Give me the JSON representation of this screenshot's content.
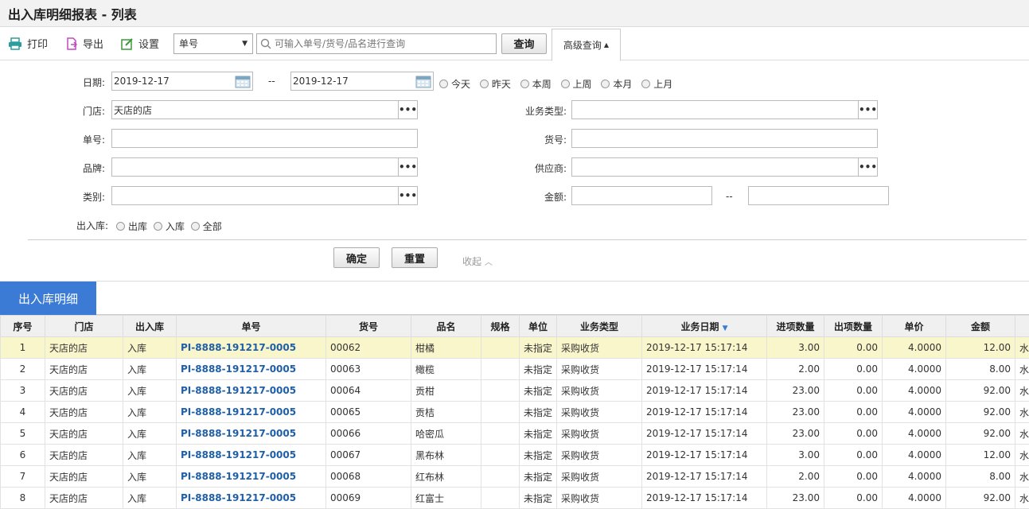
{
  "title": "出入库明细报表 - 列表",
  "toolbar": {
    "print": "打印",
    "export": "导出",
    "settings": "设置",
    "select_value": "单号",
    "search_placeholder": "可输入单号/货号/品名进行查询",
    "query": "查询",
    "advanced": "高级查询"
  },
  "form": {
    "date_label": "日期:",
    "date_from": "2019-12-17",
    "date_sep": "--",
    "date_to": "2019-12-17",
    "quick_dates": [
      "今天",
      "昨天",
      "本周",
      "上周",
      "本月",
      "上月"
    ],
    "store_label": "门店:",
    "store_value": "天店的店",
    "biztype_label": "业务类型:",
    "order_label": "单号:",
    "item_label": "货号:",
    "brand_label": "品牌:",
    "supplier_label": "供应商:",
    "category_label": "类别:",
    "amount_label": "金额:",
    "amount_sep": "--",
    "io_label": "出入库:",
    "io_options": [
      "出库",
      "入库",
      "全部"
    ],
    "confirm": "确定",
    "reset": "重置",
    "collapse": "收起",
    "dots": "•••"
  },
  "tab": "出入库明细",
  "table": {
    "headers": [
      "序号",
      "门店",
      "出入库",
      "单号",
      "货号",
      "品名",
      "规格",
      "单位",
      "业务类型",
      "业务日期",
      "进项数量",
      "出项数量",
      "单价",
      "金额",
      ""
    ],
    "rows": [
      [
        "1",
        "天店的店",
        "入库",
        "PI-8888-191217-0005",
        "00062",
        "柑橘",
        "",
        "未指定",
        "采购收货",
        "2019-12-17 15:17:14",
        "3.00",
        "0.00",
        "4.0000",
        "12.00",
        "水"
      ],
      [
        "2",
        "天店的店",
        "入库",
        "PI-8888-191217-0005",
        "00063",
        "橄榄",
        "",
        "未指定",
        "采购收货",
        "2019-12-17 15:17:14",
        "2.00",
        "0.00",
        "4.0000",
        "8.00",
        "水"
      ],
      [
        "3",
        "天店的店",
        "入库",
        "PI-8888-191217-0005",
        "00064",
        "贡柑",
        "",
        "未指定",
        "采购收货",
        "2019-12-17 15:17:14",
        "23.00",
        "0.00",
        "4.0000",
        "92.00",
        "水"
      ],
      [
        "4",
        "天店的店",
        "入库",
        "PI-8888-191217-0005",
        "00065",
        "贡桔",
        "",
        "未指定",
        "采购收货",
        "2019-12-17 15:17:14",
        "23.00",
        "0.00",
        "4.0000",
        "92.00",
        "水"
      ],
      [
        "5",
        "天店的店",
        "入库",
        "PI-8888-191217-0005",
        "00066",
        "哈密瓜",
        "",
        "未指定",
        "采购收货",
        "2019-12-17 15:17:14",
        "23.00",
        "0.00",
        "4.0000",
        "92.00",
        "水"
      ],
      [
        "6",
        "天店的店",
        "入库",
        "PI-8888-191217-0005",
        "00067",
        "黑布林",
        "",
        "未指定",
        "采购收货",
        "2019-12-17 15:17:14",
        "3.00",
        "0.00",
        "4.0000",
        "12.00",
        "水"
      ],
      [
        "7",
        "天店的店",
        "入库",
        "PI-8888-191217-0005",
        "00068",
        "红布林",
        "",
        "未指定",
        "采购收货",
        "2019-12-17 15:17:14",
        "2.00",
        "0.00",
        "4.0000",
        "8.00",
        "水"
      ],
      [
        "8",
        "天店的店",
        "入库",
        "PI-8888-191217-0005",
        "00069",
        "红富士",
        "",
        "未指定",
        "采购收货",
        "2019-12-17 15:17:14",
        "23.00",
        "0.00",
        "4.0000",
        "92.00",
        "水"
      ]
    ]
  }
}
